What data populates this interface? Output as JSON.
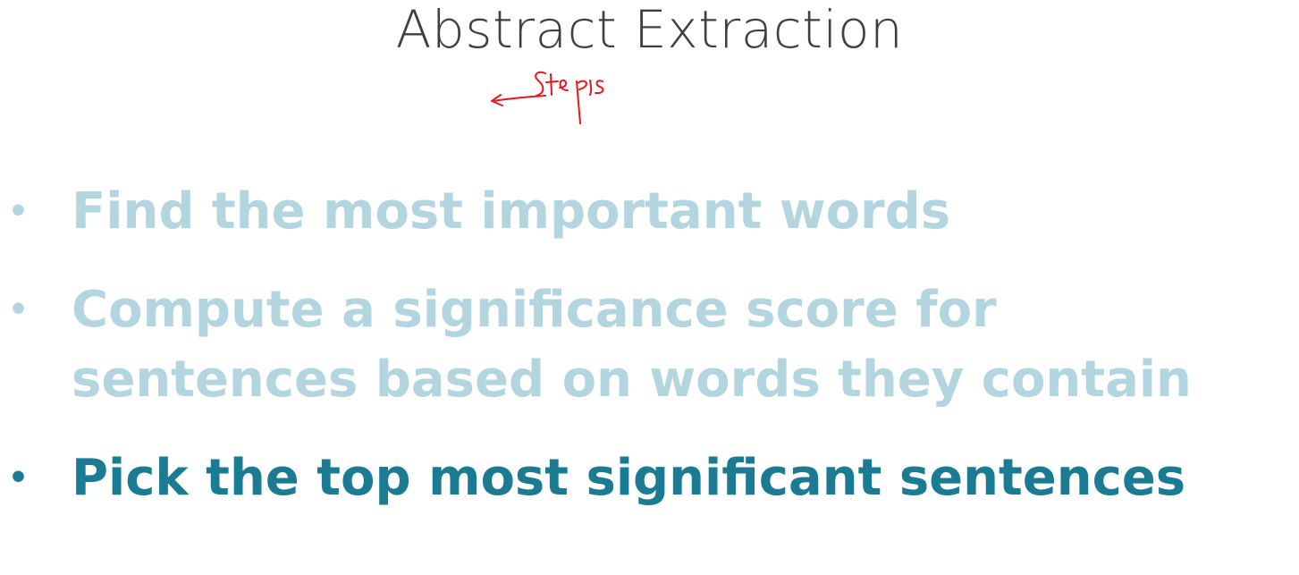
{
  "slide": {
    "title": "Abstract Extraction",
    "annotation_text": "Steps",
    "annotation_color": "#e8191d",
    "bullets": [
      {
        "text_lines": [
          "Find the most important words"
        ],
        "state": "dim"
      },
      {
        "text_lines": [
          "Compute a significance score for",
          "sentences based on words they contain"
        ],
        "state": "dim"
      },
      {
        "text_lines": [
          "Pick the top most significant sentences"
        ],
        "state": "active"
      }
    ],
    "bullet_symbol": "•",
    "colors": {
      "dim_text": "#b2d5df",
      "active_text": "#1b7b92",
      "title_text": "#3f3f3f"
    }
  }
}
